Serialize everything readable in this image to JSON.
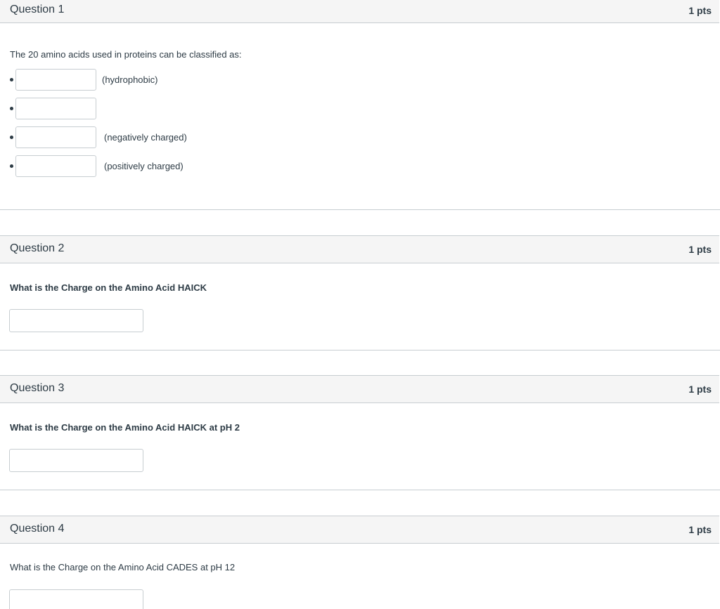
{
  "questions": [
    {
      "title": "Question 1",
      "points": "1 pts",
      "prompt": "The 20 amino acids used in proteins can be classified as:",
      "blanks": [
        {
          "value": "",
          "label": "(hydrophobic)"
        },
        {
          "value": "",
          "label": ""
        },
        {
          "value": "",
          "label": "(negatively charged)"
        },
        {
          "value": "",
          "label": "(positively charged)"
        }
      ]
    },
    {
      "title": "Question 2",
      "points": "1 pts",
      "prompt": "What is the Charge on the Amino Acid  HAICK",
      "answer": ""
    },
    {
      "title": "Question 3",
      "points": "1 pts",
      "prompt": "What is the Charge on the Amino Acid  HAICK at pH 2",
      "answer": ""
    },
    {
      "title": "Question 4",
      "points": "1 pts",
      "prompt": "What is the Charge on the Amino Acid  CADES at pH 12",
      "answer": ""
    }
  ]
}
